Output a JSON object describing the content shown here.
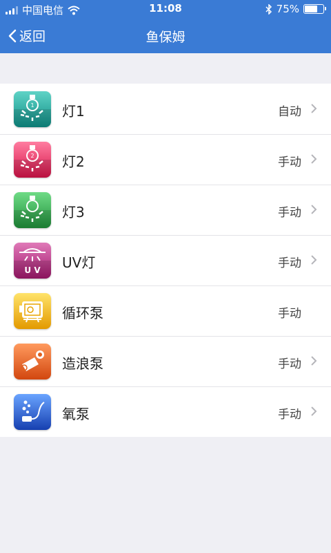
{
  "status": {
    "carrier": "中国电信",
    "time": "11:08",
    "battery": "75%",
    "battery_fraction": 0.75
  },
  "nav": {
    "back_label": "返回",
    "title": "鱼保姆"
  },
  "items": [
    {
      "label": "灯1",
      "value": "自动",
      "icon": "light-bulb-1-icon",
      "color": "#1aa39a",
      "chevron": true,
      "badge": "1"
    },
    {
      "label": "灯2",
      "value": "手动",
      "icon": "light-bulb-2-icon",
      "color": "#e8265a",
      "chevron": true,
      "badge": "2"
    },
    {
      "label": "灯3",
      "value": "手动",
      "icon": "light-bulb-3-icon",
      "color": "#2ea84c",
      "chevron": true,
      "badge": ""
    },
    {
      "label": "UV灯",
      "value": "手动",
      "icon": "uv-light-icon",
      "color": "#b0237a",
      "chevron": true,
      "badge": "U V"
    },
    {
      "label": "循环泵",
      "value": "手动",
      "icon": "circulation-pump-icon",
      "color": "#f0b400",
      "chevron": false,
      "badge": ""
    },
    {
      "label": "造浪泵",
      "value": "手动",
      "icon": "wave-pump-icon",
      "color": "#e2621f",
      "chevron": true,
      "badge": ""
    },
    {
      "label": "氧泵",
      "value": "手动",
      "icon": "air-pump-icon",
      "color": "#1e55c6",
      "chevron": true,
      "badge": ""
    }
  ]
}
